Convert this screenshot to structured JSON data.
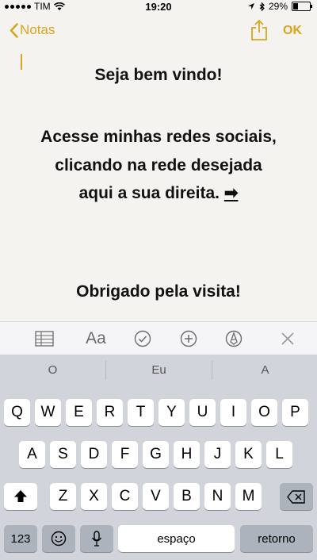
{
  "status": {
    "carrier": "TIM",
    "time": "19:20",
    "battery": "29%"
  },
  "nav": {
    "back_label": "Notas",
    "done_label": "OK"
  },
  "note": {
    "line1": "Seja bem vindo!",
    "line2": "Acesse minhas redes sociais,",
    "line3": "clicando na rede desejada",
    "line4": "aqui a sua direita.",
    "arrow": "➡",
    "line5": "Obrigado pela visita!"
  },
  "toolbar": {
    "text_style_label": "Aa"
  },
  "suggestions": [
    "O",
    "Eu",
    "A"
  ],
  "keyboard": {
    "row1": [
      "Q",
      "W",
      "E",
      "R",
      "T",
      "Y",
      "U",
      "I",
      "O",
      "P"
    ],
    "row2": [
      "A",
      "S",
      "D",
      "F",
      "G",
      "H",
      "J",
      "K",
      "L"
    ],
    "row3": [
      "Z",
      "X",
      "C",
      "V",
      "B",
      "N",
      "M"
    ],
    "numbers_label": "123",
    "space_label": "espaço",
    "return_label": "retorno"
  },
  "colors": {
    "accent": "#d9a51b",
    "keyboard_bg": "#d1d4da"
  }
}
